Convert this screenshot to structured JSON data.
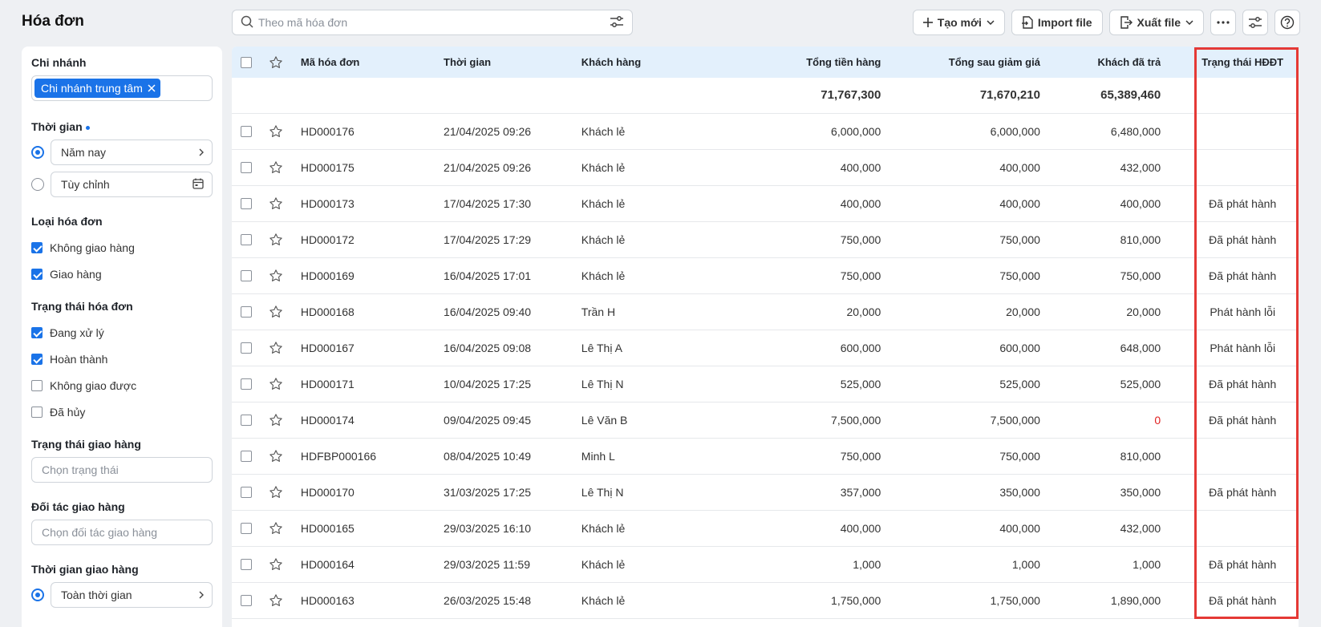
{
  "page_title": "Hóa đơn",
  "search": {
    "placeholder": "Theo mã hóa đơn"
  },
  "toolbar": {
    "create_label": "Tạo mới",
    "import_label": "Import file",
    "export_label": "Xuất file"
  },
  "sidebar": {
    "branch": {
      "title": "Chi nhánh",
      "chip": "Chi nhánh trung tâm"
    },
    "time": {
      "title": "Thời gian",
      "preset": "Năm nay",
      "custom": "Tùy chỉnh"
    },
    "invoice_type": {
      "title": "Loại hóa đơn",
      "options": [
        "Không giao hàng",
        "Giao hàng"
      ]
    },
    "invoice_status": {
      "title": "Trạng thái hóa đơn",
      "options": [
        "Đang xử lý",
        "Hoàn thành",
        "Không giao được",
        "Đã hủy"
      ]
    },
    "delivery_status": {
      "title": "Trạng thái giao hàng",
      "placeholder": "Chọn trạng thái"
    },
    "delivery_partner": {
      "title": "Đối tác giao hàng",
      "placeholder": "Chọn đối tác giao hàng"
    },
    "delivery_time": {
      "title": "Thời gian giao hàng",
      "preset": "Toàn thời gian"
    }
  },
  "table": {
    "headers": {
      "code": "Mã hóa đơn",
      "time": "Thời gian",
      "customer": "Khách hàng",
      "total": "Tổng tiền hàng",
      "after_discount": "Tổng sau giảm giá",
      "paid": "Khách đã trả",
      "einvoice_status": "Trạng thái HĐĐT"
    },
    "totals": {
      "total": "71,767,300",
      "after_discount": "71,670,210",
      "paid": "65,389,460"
    },
    "rows": [
      {
        "code": "HD000176",
        "time": "21/04/2025 09:26",
        "customer": "Khách lẻ",
        "total": "6,000,000",
        "after_discount": "6,000,000",
        "paid": "6,480,000",
        "status": ""
      },
      {
        "code": "HD000175",
        "time": "21/04/2025 09:26",
        "customer": "Khách lẻ",
        "total": "400,000",
        "after_discount": "400,000",
        "paid": "432,000",
        "status": ""
      },
      {
        "code": "HD000173",
        "time": "17/04/2025 17:30",
        "customer": "Khách lẻ",
        "total": "400,000",
        "after_discount": "400,000",
        "paid": "400,000",
        "status": "Đã phát hành"
      },
      {
        "code": "HD000172",
        "time": "17/04/2025 17:29",
        "customer": "Khách lẻ",
        "total": "750,000",
        "after_discount": "750,000",
        "paid": "810,000",
        "status": "Đã phát hành"
      },
      {
        "code": "HD000169",
        "time": "16/04/2025 17:01",
        "customer": "Khách lẻ",
        "total": "750,000",
        "after_discount": "750,000",
        "paid": "750,000",
        "status": "Đã phát hành"
      },
      {
        "code": "HD000168",
        "time": "16/04/2025 09:40",
        "customer": "Trần H",
        "total": "20,000",
        "after_discount": "20,000",
        "paid": "20,000",
        "status": "Phát hành lỗi"
      },
      {
        "code": "HD000167",
        "time": "16/04/2025 09:08",
        "customer": "Lê Thị A",
        "total": "600,000",
        "after_discount": "600,000",
        "paid": "648,000",
        "status": "Phát hành lỗi"
      },
      {
        "code": "HD000171",
        "time": "10/04/2025 17:25",
        "customer": "Lê Thị N",
        "total": "525,000",
        "after_discount": "525,000",
        "paid": "525,000",
        "status": "Đã phát hành"
      },
      {
        "code": "HD000174",
        "time": "09/04/2025 09:45",
        "customer": "Lê Văn B",
        "total": "7,500,000",
        "after_discount": "7,500,000",
        "paid": "0",
        "status": "Đã phát hành"
      },
      {
        "code": "HDFBP000166",
        "time": "08/04/2025 10:49",
        "customer": "Minh L",
        "total": "750,000",
        "after_discount": "750,000",
        "paid": "810,000",
        "status": ""
      },
      {
        "code": "HD000170",
        "time": "31/03/2025 17:25",
        "customer": "Lê Thị N",
        "total": "357,000",
        "after_discount": "350,000",
        "paid": "350,000",
        "status": "Đã phát hành"
      },
      {
        "code": "HD000165",
        "time": "29/03/2025 16:10",
        "customer": "Khách lẻ",
        "total": "400,000",
        "after_discount": "400,000",
        "paid": "432,000",
        "status": ""
      },
      {
        "code": "HD000164",
        "time": "29/03/2025 11:59",
        "customer": "Khách lẻ",
        "total": "1,000",
        "after_discount": "1,000",
        "paid": "1,000",
        "status": "Đã phát hành"
      },
      {
        "code": "HD000163",
        "time": "26/03/2025 15:48",
        "customer": "Khách lẻ",
        "total": "1,750,000",
        "after_discount": "1,750,000",
        "paid": "1,890,000",
        "status": "Đã phát hành"
      }
    ]
  },
  "colors": {
    "accent": "#1a73e8",
    "header_bg": "#e3f0fc",
    "highlight": "#e53935",
    "negative": "#e02020"
  }
}
